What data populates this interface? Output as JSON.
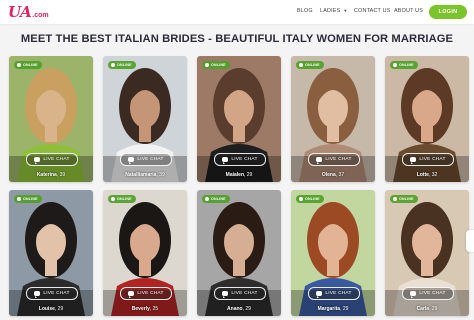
{
  "logo": {
    "main": "UA",
    "suffix": ".com"
  },
  "nav": {
    "blog": "BLOG",
    "ladies": "LADIES",
    "contact": "CONTACT US",
    "about": "ABOUT US",
    "login": "LOGIN"
  },
  "page_title": "MEET THE BEST ITALIAN BRIDES - BEAUTIFUL ITALY WOMEN FOR MARRIAGE",
  "badge_label": "ONLINE",
  "chat_label": "LIVE CHAT",
  "colors": {
    "accent_pink": "#e0245e",
    "login_green": "#7bc42c",
    "online_green": "#50a028"
  },
  "cards": [
    {
      "name": "Katerina",
      "age": "39"
    },
    {
      "name": "Natalliamaria",
      "age": "39"
    },
    {
      "name": "Maialen",
      "age": "29"
    },
    {
      "name": "Olena",
      "age": "37"
    },
    {
      "name": "Lotte",
      "age": "32"
    },
    {
      "name": "Louise",
      "age": "29"
    },
    {
      "name": "Beverly",
      "age": "25"
    },
    {
      "name": "Anano",
      "age": "29"
    },
    {
      "name": "Margarita",
      "age": "29"
    },
    {
      "name": "Carla",
      "age": "29"
    }
  ]
}
